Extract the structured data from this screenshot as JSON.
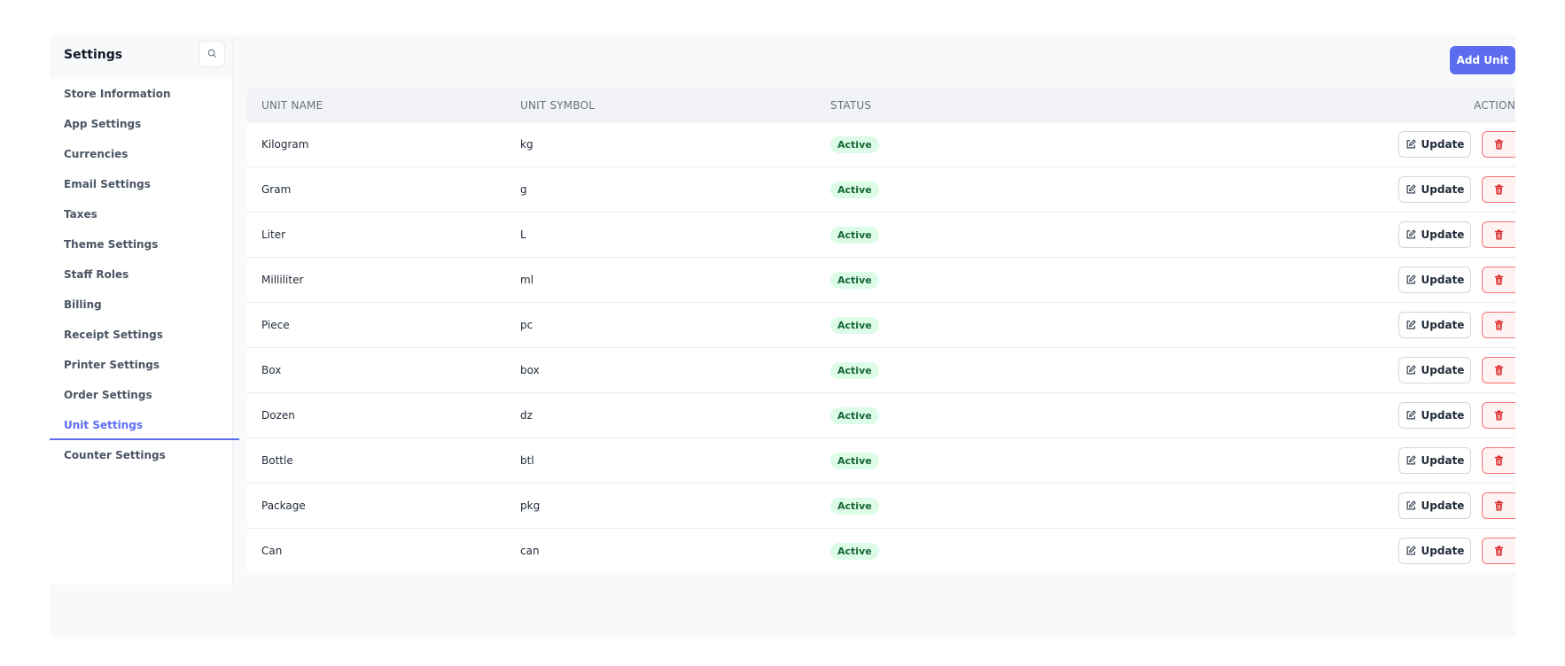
{
  "sidebar": {
    "title": "Settings",
    "search_icon": "search-icon",
    "items": [
      {
        "label": "Store Information",
        "active": false
      },
      {
        "label": "App Settings",
        "active": false
      },
      {
        "label": "Currencies",
        "active": false
      },
      {
        "label": "Email Settings",
        "active": false
      },
      {
        "label": "Taxes",
        "active": false
      },
      {
        "label": "Theme Settings",
        "active": false
      },
      {
        "label": "Staff Roles",
        "active": false
      },
      {
        "label": "Billing",
        "active": false
      },
      {
        "label": "Receipt Settings",
        "active": false
      },
      {
        "label": "Printer Settings",
        "active": false
      },
      {
        "label": "Order Settings",
        "active": false
      },
      {
        "label": "Unit Settings",
        "active": true
      },
      {
        "label": "Counter Settings",
        "active": false
      }
    ]
  },
  "toolbar": {
    "add_label": "Add Unit"
  },
  "table": {
    "headers": {
      "name": "UNIT NAME",
      "symbol": "UNIT SYMBOL",
      "status": "STATUS",
      "action": "ACTION"
    },
    "update_label": "Update",
    "rows": [
      {
        "name": "Kilogram",
        "symbol": "kg",
        "status": "Active"
      },
      {
        "name": "Gram",
        "symbol": "g",
        "status": "Active"
      },
      {
        "name": "Liter",
        "symbol": "L",
        "status": "Active"
      },
      {
        "name": "Milliliter",
        "symbol": "ml",
        "status": "Active"
      },
      {
        "name": "Piece",
        "symbol": "pc",
        "status": "Active"
      },
      {
        "name": "Box",
        "symbol": "box",
        "status": "Active"
      },
      {
        "name": "Dozen",
        "symbol": "dz",
        "status": "Active"
      },
      {
        "name": "Bottle",
        "symbol": "btl",
        "status": "Active"
      },
      {
        "name": "Package",
        "symbol": "pkg",
        "status": "Active"
      },
      {
        "name": "Can",
        "symbol": "can",
        "status": "Active"
      }
    ]
  },
  "colors": {
    "accent": "#5b6cf0",
    "badge_bg": "#dcfce7",
    "badge_text": "#166534",
    "danger": "#dc2626"
  }
}
